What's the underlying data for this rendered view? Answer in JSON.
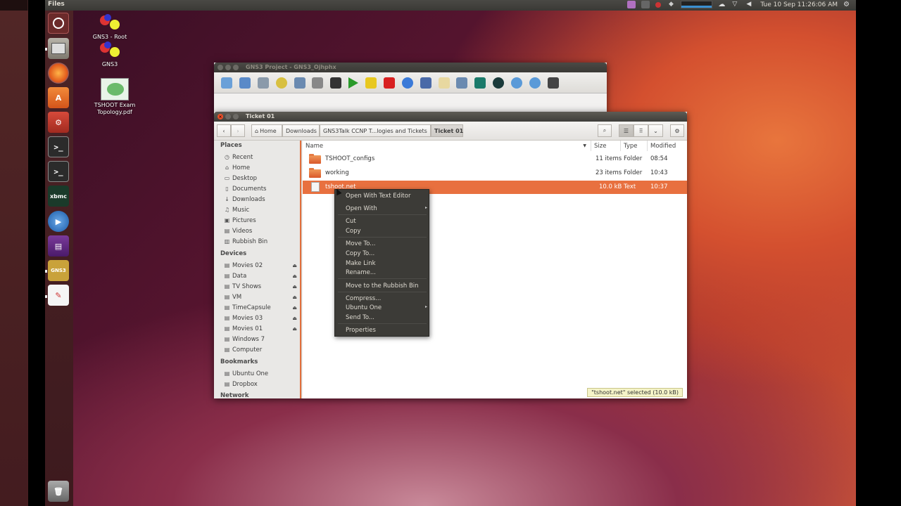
{
  "top_panel": {
    "app_title": "Files",
    "clock": "Tue 10 Sep  11:26:06 AM"
  },
  "launcher": {
    "items": [
      "dash-home",
      "files",
      "firefox",
      "software-center",
      "system-settings",
      "terminal",
      "terminal",
      "xbmc",
      "media-player",
      "video",
      "gns3",
      "gedit",
      "trash"
    ]
  },
  "desktop": {
    "icons": [
      {
        "label": "GNS3 - Root"
      },
      {
        "label": "GNS3"
      },
      {
        "label": "TSHOOT Exam Topology.pdf"
      }
    ]
  },
  "gns3_window": {
    "title": "GNS3 Project - GNS3_Ojhphx"
  },
  "files_window": {
    "title": "Ticket 01",
    "breadcrumbs": [
      "Home",
      "Downloads",
      "GNS3Talk CCNP T...logies and Tickets",
      "Ticket 01"
    ],
    "sidebar": {
      "places_header": "Places",
      "places": [
        "Recent",
        "Home",
        "Desktop",
        "Documents",
        "Downloads",
        "Music",
        "Pictures",
        "Videos",
        "Rubbish Bin"
      ],
      "devices_header": "Devices",
      "devices": [
        "Movies 02",
        "Data",
        "TV Shows",
        "VM",
        "TimeCapsule",
        "Movies 03",
        "Movies 01",
        "Windows 7",
        "Computer"
      ],
      "bookmarks_header": "Bookmarks",
      "bookmarks": [
        "Ubuntu One",
        "Dropbox"
      ],
      "network_header": "Network"
    },
    "columns": {
      "name": "Name",
      "size": "Size",
      "type": "Type",
      "modified": "Modified"
    },
    "files": [
      {
        "name": "TSHOOT_configs",
        "size": "11 items",
        "type": "Folder",
        "modified": "08:54"
      },
      {
        "name": "working",
        "size": "23 items",
        "type": "Folder",
        "modified": "10:43"
      },
      {
        "name": "tshoot.net",
        "size": "10.0 kB",
        "type": "Text",
        "modified": "10:37"
      }
    ],
    "status": "\"tshoot.net\" selected  (10.0 kB)"
  },
  "context_menu": {
    "items": [
      "Open With Text Editor",
      "Open With",
      "Cut",
      "Copy",
      "Move To...",
      "Copy To...",
      "Make Link",
      "Rename...",
      "Move to the Rubbish Bin",
      "Compress...",
      "Ubuntu One",
      "Send To...",
      "Properties"
    ]
  }
}
